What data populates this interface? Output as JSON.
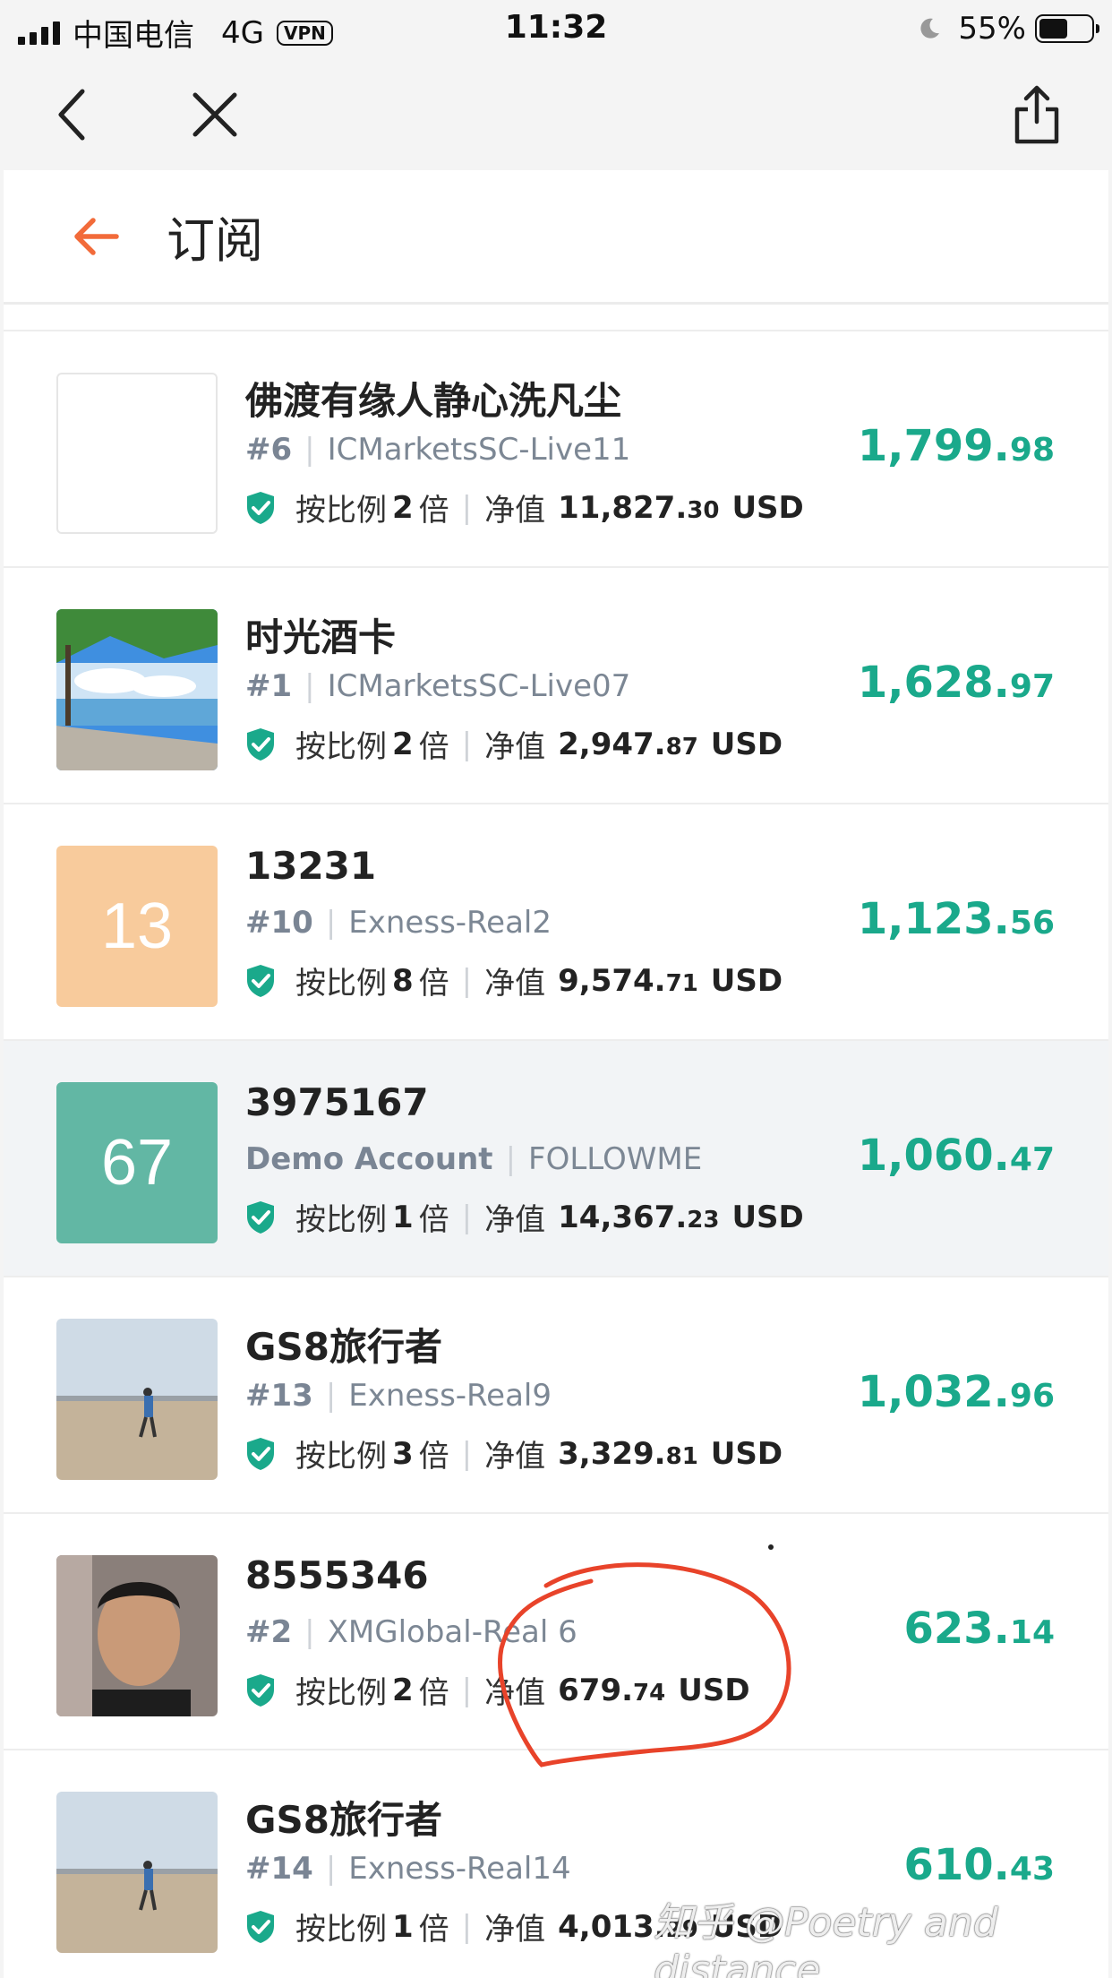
{
  "status_bar": {
    "carrier": "中国电信",
    "network": "4G",
    "vpn": "VPN",
    "time": "11:32",
    "battery": "55%",
    "battery_level": 0.55
  },
  "browser": {
    "back_icon": "chevron-left-icon",
    "close_icon": "close-icon",
    "share_icon": "share-icon"
  },
  "header": {
    "title": "订阅"
  },
  "labels": {
    "ratio_prefix": "按比例",
    "ratio_suffix": "倍",
    "equity_label": "净值",
    "currency": "USD"
  },
  "subscriptions": [
    {
      "name": "佛渡有缘人静心洗凡尘",
      "rank": "#6",
      "server": "ICMarketsSC-Live11",
      "ratio": "2",
      "equity_int": "11,827.",
      "equity_dec": "30",
      "profit_int": "1,799.",
      "profit_dec": "98",
      "avatar": {
        "type": "blank"
      }
    },
    {
      "name": "时光酒卡",
      "rank": "#1",
      "server": "ICMarketsSC-Live07",
      "ratio": "2",
      "equity_int": "2,947.",
      "equity_dec": "87",
      "profit_int": "1,628.",
      "profit_dec": "97",
      "avatar": {
        "type": "photo-seaside"
      }
    },
    {
      "name": "13231",
      "rank": "#10",
      "server": "Exness-Real2",
      "ratio": "8",
      "equity_int": "9,574.",
      "equity_dec": "71",
      "profit_int": "1,123.",
      "profit_dec": "56",
      "avatar": {
        "type": "text",
        "text": "13",
        "color": "#f8cb9c"
      }
    },
    {
      "name": "3975167",
      "rank": "Demo Account",
      "server": "FOLLOWME",
      "ratio": "1",
      "equity_int": "14,367.",
      "equity_dec": "23",
      "profit_int": "1,060.",
      "profit_dec": "47",
      "avatar": {
        "type": "text",
        "text": "67",
        "color": "#62b7a4"
      }
    },
    {
      "name": "GS8旅行者",
      "rank": "#13",
      "server": "Exness-Real9",
      "ratio": "3",
      "equity_int": "3,329.",
      "equity_dec": "81",
      "profit_int": "1,032.",
      "profit_dec": "96",
      "avatar": {
        "type": "photo-desert"
      }
    },
    {
      "name": "8555346",
      "rank": "#2",
      "server": "XMGlobal-Real 6",
      "ratio": "2",
      "equity_int": "679.",
      "equity_dec": "74",
      "profit_int": "623.",
      "profit_dec": "14",
      "avatar": {
        "type": "photo-portrait"
      }
    },
    {
      "name": "GS8旅行者",
      "rank": "#14",
      "server": "Exness-Real14",
      "ratio": "1",
      "equity_int": "4,013.",
      "equity_dec": "29",
      "profit_int": "610.",
      "profit_dec": "43",
      "avatar": {
        "type": "photo-desert"
      }
    }
  ],
  "colors": {
    "accent": "#f26b3a",
    "profit": "#1aa98b",
    "shield": "#1aa98b",
    "annotation": "#e8432a"
  },
  "watermark": "知乎 @Poetry and distance"
}
